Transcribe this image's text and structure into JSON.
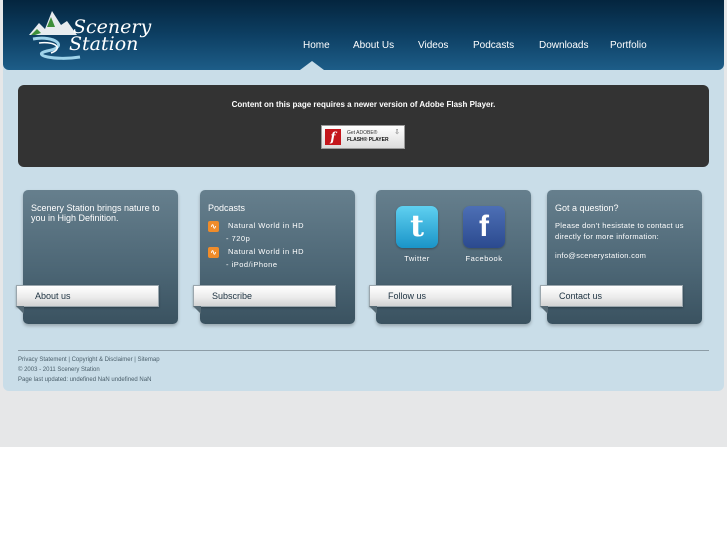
{
  "brand": {
    "logo_line1": "Scenery",
    "logo_line2": "Station"
  },
  "nav": {
    "items": [
      {
        "label": "Home"
      },
      {
        "label": "About Us"
      },
      {
        "label": "Videos"
      },
      {
        "label": "Podcasts"
      },
      {
        "label": "Downloads"
      },
      {
        "label": "Portfolio"
      }
    ],
    "active": "Home"
  },
  "flash": {
    "message": "Content on this page requires a newer version of Adobe Flash Player.",
    "badge_get": "Get ADOBE®",
    "badge_player": "FLASH® PLAYER",
    "badge_logo": "f"
  },
  "cards": {
    "about": {
      "text": "Scenery Station brings nature to you in High Definition.",
      "button": "About us"
    },
    "podcasts": {
      "heading": "Podcasts",
      "items": [
        {
          "title": "Natural World in HD",
          "sub": "- 720p"
        },
        {
          "title": "Natural World in HD",
          "sub": "- iPod/iPhone"
        }
      ],
      "button": "Subscribe"
    },
    "follow": {
      "twitter": "Twitter",
      "facebook": "Facebook",
      "button": "Follow us"
    },
    "contact": {
      "heading": "Got a question?",
      "body": "Please don’t hesistate to contact us directly for more information:",
      "email": "info@scenerystation.com",
      "button": "Contact us"
    }
  },
  "footer": {
    "privacy": "Privacy Statement",
    "sep1": " | ",
    "copyright_link": "Copyright & Disclaimer",
    "sep2": " | ",
    "sitemap": "Sitemap",
    "copyright": "© 2003 - 2011 Scenery Station",
    "last_updated": "Page last updated: undefined NaN undefined NaN"
  },
  "colors": {
    "header_dark": "#04253e",
    "panel": "#c9dde8",
    "card": "#4c6675",
    "rss": "#f08c2a",
    "twitter": "#1a94c8",
    "facebook": "#3b5998"
  },
  "icons": [
    "scenery-logo-icon",
    "rss-icon",
    "twitter-icon",
    "facebook-icon",
    "flash-logo-icon",
    "download-arrow-icon"
  ]
}
